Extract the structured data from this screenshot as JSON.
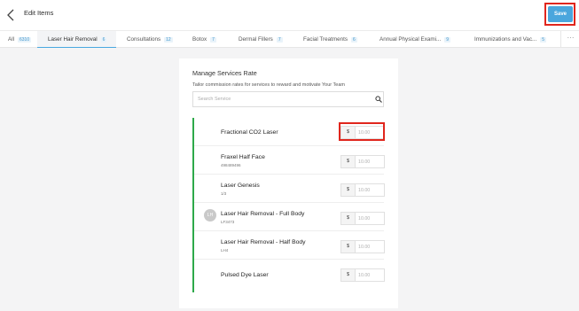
{
  "header": {
    "title": "Edit Items",
    "save_label": "Save"
  },
  "tabs": [
    {
      "label": "All",
      "count": "6310"
    },
    {
      "label": "Laser Hair Removal",
      "count": "6",
      "active": true
    },
    {
      "label": "Consultations",
      "count": "12"
    },
    {
      "label": "Botox",
      "count": "7"
    },
    {
      "label": "Dermal Fillers",
      "count": "7"
    },
    {
      "label": "Facial Treatments",
      "count": "6"
    },
    {
      "label": "Annual Physical Exami...",
      "count": "9"
    },
    {
      "label": "Immunizations and Vac...",
      "count": "5"
    }
  ],
  "tabs_more": "···",
  "card": {
    "title": "Manage Services Rate",
    "subtitle": "Tailor commission rates for services to reward and motivate Your Team",
    "search_placeholder": "Search Service"
  },
  "services": [
    {
      "name": "Fractional CO2 Laser",
      "code": "",
      "avatar": "",
      "currency": "$",
      "rate_placeholder": "10.00"
    },
    {
      "name": "Fraxel Half Face",
      "code": "498489496",
      "avatar": "",
      "currency": "$",
      "rate_placeholder": "10.00"
    },
    {
      "name": "Laser Genesis",
      "code": "1/3",
      "avatar": "",
      "currency": "$",
      "rate_placeholder": "10.00"
    },
    {
      "name": "Laser Hair Removal - Full Body",
      "code": "LF3473",
      "avatar": "LH",
      "currency": "$",
      "rate_placeholder": "10.00"
    },
    {
      "name": "Laser Hair Removal - Half Body",
      "code": "LH4",
      "avatar": "",
      "currency": "$",
      "rate_placeholder": "10.00"
    },
    {
      "name": "Pulsed Dye Laser",
      "code": "",
      "avatar": "",
      "currency": "$",
      "rate_placeholder": "10.00"
    }
  ],
  "colors": {
    "accent": "#4aa6dd",
    "highlight": "#e0261d",
    "list_border": "#2ea94a",
    "count": "#3f95cc"
  }
}
